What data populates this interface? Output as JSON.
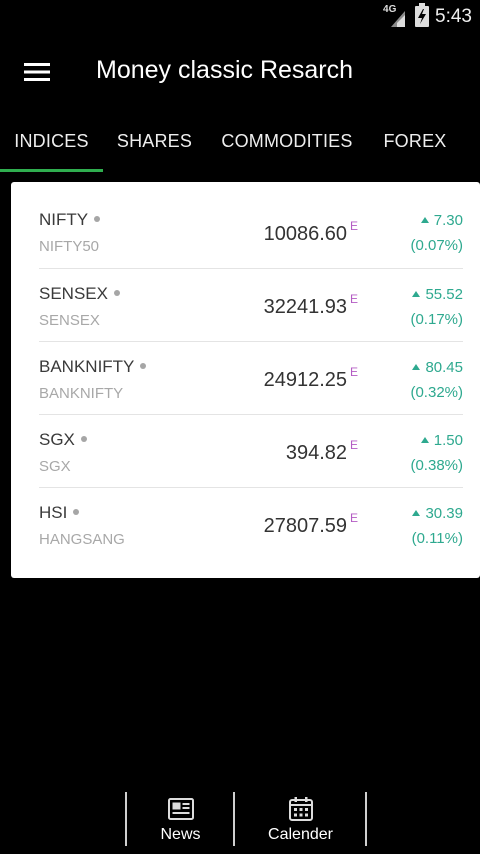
{
  "status_bar": {
    "network": "4G",
    "time": "5:43"
  },
  "app_bar": {
    "title": "Money classic Resarch",
    "menu_icon": "hamburger-menu-icon"
  },
  "tabs": [
    {
      "label": "INDICES",
      "active": true
    },
    {
      "label": "SHARES",
      "active": false
    },
    {
      "label": "COMMODITIES",
      "active": false
    },
    {
      "label": "FOREX",
      "active": false
    }
  ],
  "indices": [
    {
      "name": "NIFTY",
      "code": "NIFTY50",
      "price": "10086.60",
      "flag": "E",
      "change": "7.30",
      "percent": "(0.07%)"
    },
    {
      "name": "SENSEX",
      "code": "SENSEX",
      "price": "32241.93",
      "flag": "E",
      "change": "55.52",
      "percent": "(0.17%)"
    },
    {
      "name": "BANKNIFTY",
      "code": "BANKNIFTY",
      "price": "24912.25",
      "flag": "E",
      "change": "80.45",
      "percent": "(0.32%)"
    },
    {
      "name": "SGX",
      "code": "SGX",
      "price": "394.82",
      "flag": "E",
      "change": "1.50",
      "percent": "(0.38%)"
    },
    {
      "name": "HSI",
      "code": "HANGSANG",
      "price": "27807.59",
      "flag": "E",
      "change": "30.39",
      "percent": "(0.11%)"
    }
  ],
  "bottom_nav": [
    {
      "label": "News",
      "icon": "newspaper-icon"
    },
    {
      "label": "Calender",
      "icon": "calendar-icon"
    }
  ],
  "colors": {
    "accent": "#2fae4f",
    "positive": "#2ea98f",
    "flag": "#b45cc4"
  }
}
